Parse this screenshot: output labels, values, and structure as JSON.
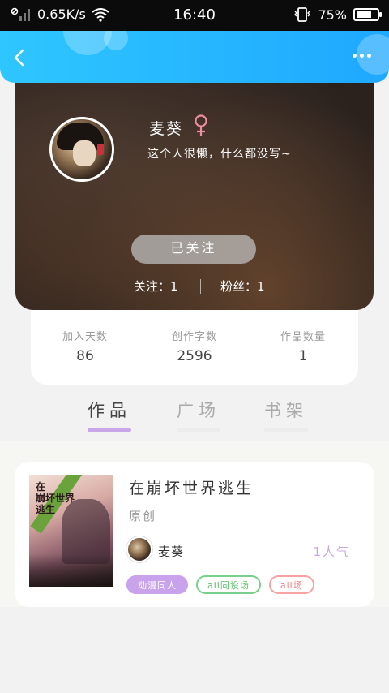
{
  "status_bar": {
    "net_speed": "0.65K/s",
    "time": "16:40",
    "battery": "75%",
    "battery_level": 0.75
  },
  "header": {
    "back_icon": "chevron-left-icon",
    "more_icon": "more-horizontal-icon"
  },
  "profile": {
    "username": "麦葵",
    "gender_icon": "female-symbol-icon",
    "bio": "这个人很懒，什么都没写~",
    "follow_button": "已关注",
    "following_label": "关注：1",
    "fans_label": "粉丝：1"
  },
  "stats": [
    {
      "label": "加入天数",
      "value": "86"
    },
    {
      "label": "创作字数",
      "value": "2596"
    },
    {
      "label": "作品数量",
      "value": "1"
    }
  ],
  "tabs": [
    {
      "label": "作品",
      "active": true
    },
    {
      "label": "广场",
      "active": false
    },
    {
      "label": "书架",
      "active": false
    }
  ],
  "works": [
    {
      "title": "在崩坏世界逃生",
      "type": "原创",
      "cover_text": "在\n崩坏世界\n逃生",
      "author": "麦葵",
      "popularity": "1人气",
      "tags": [
        "动漫同人",
        "all同设场",
        "all场"
      ]
    }
  ],
  "colors": {
    "header": "#1fa8ff",
    "accent_purple": "#c9a6e8",
    "tag_green": "#5bbf6a",
    "tag_red": "#f08080"
  }
}
